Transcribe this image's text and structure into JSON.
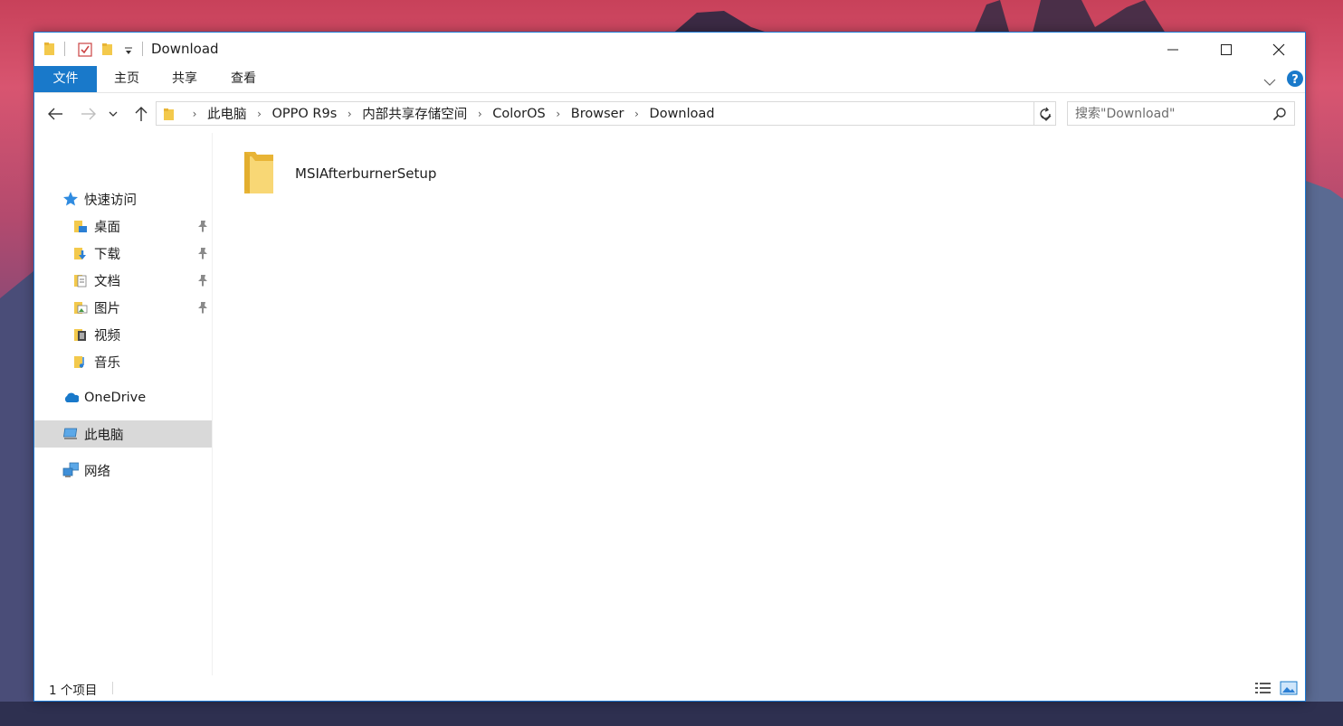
{
  "window": {
    "title": "Download",
    "accent": "#1979ca"
  },
  "ribbon": {
    "tabs": [
      {
        "label": "文件"
      },
      {
        "label": "主页"
      },
      {
        "label": "共享"
      },
      {
        "label": "查看"
      }
    ]
  },
  "address": {
    "crumbs": [
      "此电脑",
      "OPPO R9s",
      "内部共享存储空间",
      "ColorOS",
      "Browser",
      "Download"
    ]
  },
  "search": {
    "placeholder": "搜索\"Download\""
  },
  "navpane": {
    "quick_access": "快速访问",
    "quick_items": [
      {
        "label": "桌面",
        "icon": "desktop-folder-icon",
        "pinned": true
      },
      {
        "label": "下载",
        "icon": "downloads-folder-icon",
        "pinned": true
      },
      {
        "label": "文档",
        "icon": "documents-folder-icon",
        "pinned": true
      },
      {
        "label": "图片",
        "icon": "pictures-folder-icon",
        "pinned": true
      },
      {
        "label": "视频",
        "icon": "videos-folder-icon",
        "pinned": false
      },
      {
        "label": "音乐",
        "icon": "music-folder-icon",
        "pinned": false
      }
    ],
    "onedrive": "OneDrive",
    "this_pc": "此电脑",
    "network": "网络"
  },
  "content": {
    "items": [
      {
        "name": "MSIAfterburnerSetup",
        "icon": "folder-icon"
      }
    ]
  },
  "status": {
    "count": "1 个项目"
  }
}
